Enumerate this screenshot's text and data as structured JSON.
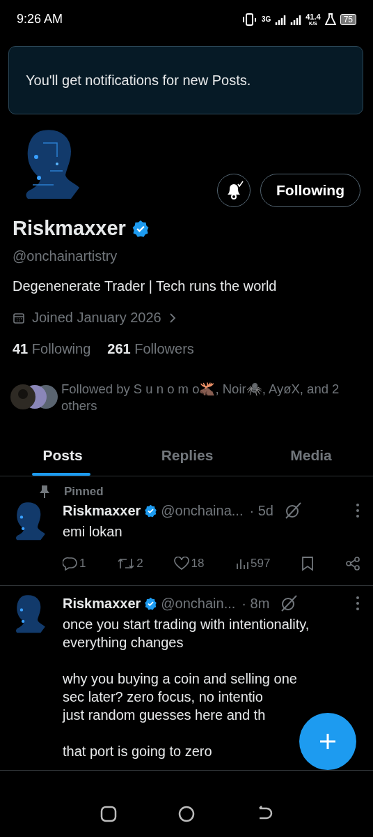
{
  "status_bar": {
    "time": "9:26 AM",
    "network": "3G",
    "speed": "41.4",
    "speed_unit": "K/S",
    "battery": "75"
  },
  "toast": {
    "text": "You'll get notifications for new Posts."
  },
  "profile": {
    "name": "Riskmaxxer",
    "verified": true,
    "handle": "@onchainartistry",
    "bio": "Degenenerate Trader | Tech runs the world",
    "joined": "Joined January 2026",
    "notifications_on": true,
    "follow_button": "Following",
    "stats": [
      {
        "count": "41",
        "label": "Following"
      },
      {
        "count": "261",
        "label": "Followers"
      }
    ],
    "followed_by": "Followed by S u n o m o🫎, Noir🕷️, AyøX, and 2 others"
  },
  "tabs": [
    {
      "label": "Posts",
      "selected": true
    },
    {
      "label": "Replies",
      "selected": false
    },
    {
      "label": "Media",
      "selected": false
    }
  ],
  "posts": [
    {
      "pinned": true,
      "pinned_label": "Pinned",
      "name": "Riskmaxxer",
      "verified": true,
      "handle": "@onchaina...",
      "time": "· 5d",
      "paragraphs": [
        [
          "emi lokan"
        ]
      ],
      "actions": {
        "replies": "1",
        "reposts": "2",
        "likes": "18",
        "views": "597"
      }
    },
    {
      "name": "Riskmaxxer",
      "verified": true,
      "handle": "@onchain...",
      "time": "· 8m",
      "paragraphs": [
        [
          "once you start trading with intentionality,",
          "everything changes"
        ],
        [
          "why you buying a coin and selling one",
          "sec later? zero focus, no intentio",
          "just random guesses here and th"
        ],
        [
          "that port is going to zero"
        ]
      ]
    }
  ]
}
